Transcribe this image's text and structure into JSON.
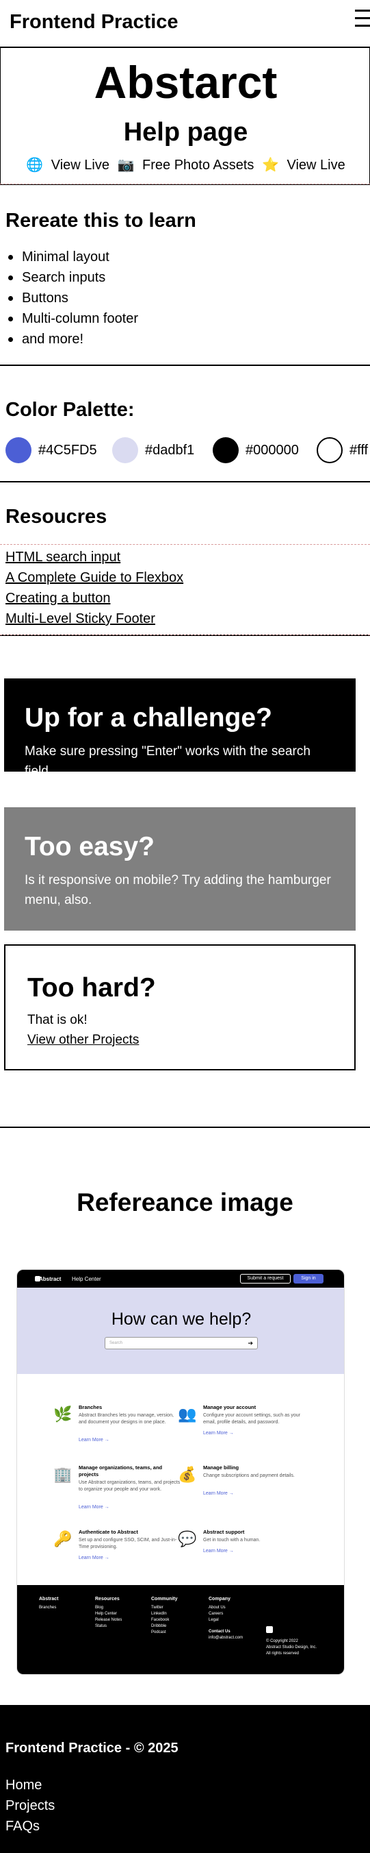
{
  "header": {
    "brand": "Frontend Practice",
    "menu_icon": "hamburger-icon"
  },
  "hero": {
    "title": "Abstarct",
    "subtitle": "Help page",
    "links": [
      {
        "icon": "🌐",
        "label": "View Live"
      },
      {
        "icon": "📷",
        "label": "Free Photo Assets"
      },
      {
        "icon": "⭐",
        "label": "View Live"
      }
    ]
  },
  "learn": {
    "title": "Rereate this to learn",
    "items": [
      "Minimal layout",
      "Search inputs",
      "Buttons",
      "Multi-column footer",
      "and more!"
    ]
  },
  "palette": {
    "title": "Color Palette:",
    "colors": [
      {
        "hex": "#4C5FD5",
        "label": "#4C5FD5"
      },
      {
        "hex": "#dadbf1",
        "label": "#dadbf1"
      },
      {
        "hex": "#000000",
        "label": "#000000"
      },
      {
        "hex": "#ffffff",
        "label": "#fff"
      }
    ]
  },
  "resources": {
    "title": "Resoucres",
    "links": [
      "HTML search input",
      "A Complete Guide to Flexbox",
      "Creating a button",
      "Multi-Level Sticky Footer"
    ]
  },
  "cards": {
    "challenge": {
      "title": "Up for a challenge?",
      "text": "Make sure pressing \"Enter\" works with the search field."
    },
    "easy": {
      "title": "Too easy?",
      "text": "Is it responsive on mobile? Try adding the hamburger menu, also."
    },
    "hard": {
      "title": "Too hard?",
      "text": "That is ok!",
      "link": "View other Projects"
    }
  },
  "reference": {
    "title": "Refereance image",
    "mock": {
      "logo": "Abstract",
      "section": "Help Center",
      "request": "Submit a request",
      "signin": "Sign in",
      "headline": "How can we help?",
      "search_placeholder": "Search",
      "learn_more": "Learn More →",
      "items": [
        {
          "icon": "🌿",
          "title": "Branches",
          "desc": "Abstract Branches lets you manage, version, and document your designs in one place."
        },
        {
          "icon": "👥",
          "title": "Manage your account",
          "desc": "Configure your account settings, such as your email, profile details, and password."
        },
        {
          "icon": "🏢",
          "title": "Manage organizations, teams, and projects",
          "desc": "Use Abstract organizations, teams, and projects to organize your people and your work."
        },
        {
          "icon": "💰",
          "title": "Manage billing",
          "desc": "Change subscriptions and payment details."
        },
        {
          "icon": "🔑",
          "title": "Authenticate to Abstract",
          "desc": "Set up and configure SSO, SCIM, and Just-in-Time provisioning."
        },
        {
          "icon": "💬",
          "title": "Abstract support",
          "desc": "Get in touch with a human."
        }
      ],
      "footer": {
        "cols": [
          {
            "title": "Abstract",
            "links": [
              "Branches"
            ]
          },
          {
            "title": "Resources",
            "links": [
              "Blog",
              "Help Center",
              "Release Notes",
              "Status"
            ]
          },
          {
            "title": "Community",
            "links": [
              "Twitter",
              "LinkedIn",
              "Facebook",
              "Dribbble",
              "Podcast"
            ]
          },
          {
            "title": "Company",
            "links": [
              "About Us",
              "Careers",
              "Legal"
            ]
          }
        ],
        "contact_title": "Contact Us",
        "contact_email": "info@abstract.com",
        "copyright": "© Copyright 2022",
        "company": "Abstract Studio Design, Inc.",
        "rights": "All rights reserved"
      }
    }
  },
  "footer": {
    "copyright": "Frontend Practice - © 2025",
    "nav": [
      "Home",
      "Projects",
      "FAQs"
    ]
  }
}
